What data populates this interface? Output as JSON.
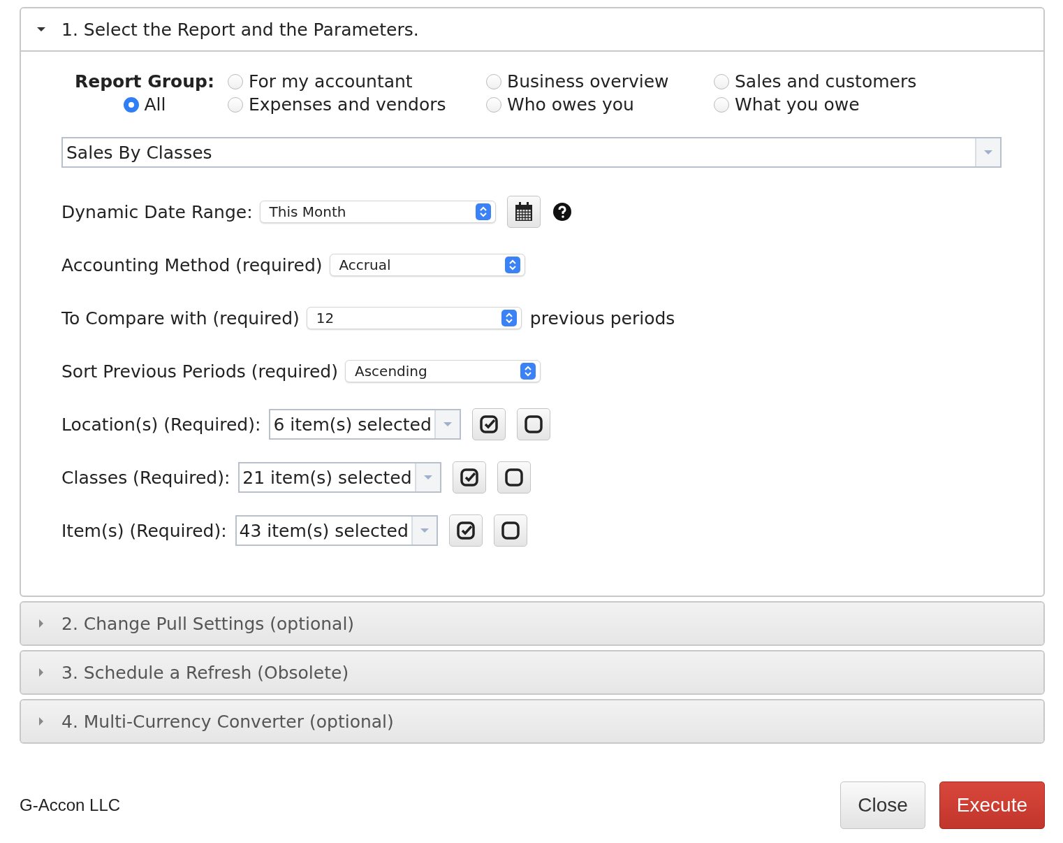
{
  "sections": [
    {
      "title": "1. Select the Report and the Parameters.",
      "expanded": true
    },
    {
      "title": "2. Change Pull Settings (optional)",
      "expanded": false
    },
    {
      "title": "3. Schedule a Refresh (Obsolete)",
      "expanded": false
    },
    {
      "title": "4. Multi-Currency Converter (optional)",
      "expanded": false
    }
  ],
  "report_group": {
    "label": "Report Group:",
    "options": [
      {
        "label": "For my accountant",
        "selected": false
      },
      {
        "label": "Business overview",
        "selected": false
      },
      {
        "label": "Sales and customers",
        "selected": false
      },
      {
        "label": "All",
        "selected": true
      },
      {
        "label": "Expenses and vendors",
        "selected": false
      },
      {
        "label": "Who owes you",
        "selected": false
      },
      {
        "label": "What you owe",
        "selected": false
      }
    ]
  },
  "report": {
    "value": "Sales By Classes"
  },
  "parameters": [
    {
      "kind": "date",
      "label": "Dynamic Date Range:",
      "value": "This Month"
    },
    {
      "kind": "select",
      "label": "Accounting Method (required)",
      "value": "Accrual"
    },
    {
      "kind": "select",
      "label": "To Compare with (required)",
      "value": "12",
      "suffix": "previous periods"
    },
    {
      "kind": "select",
      "label": "Sort Previous Periods (required)",
      "value": "Ascending"
    },
    {
      "kind": "multi",
      "label": "Location(s) (Required):",
      "value": "6 item(s) selected"
    },
    {
      "kind": "multi",
      "label": "Classes (Required):",
      "value": "21 item(s) selected"
    },
    {
      "kind": "multi",
      "label": "Item(s) (Required):",
      "value": "43 item(s) selected"
    }
  ],
  "footer": {
    "company": "G-Accon LLC",
    "buttons": [
      {
        "label": "Close",
        "kind": "default"
      },
      {
        "label": "Execute",
        "kind": "primary"
      }
    ]
  }
}
